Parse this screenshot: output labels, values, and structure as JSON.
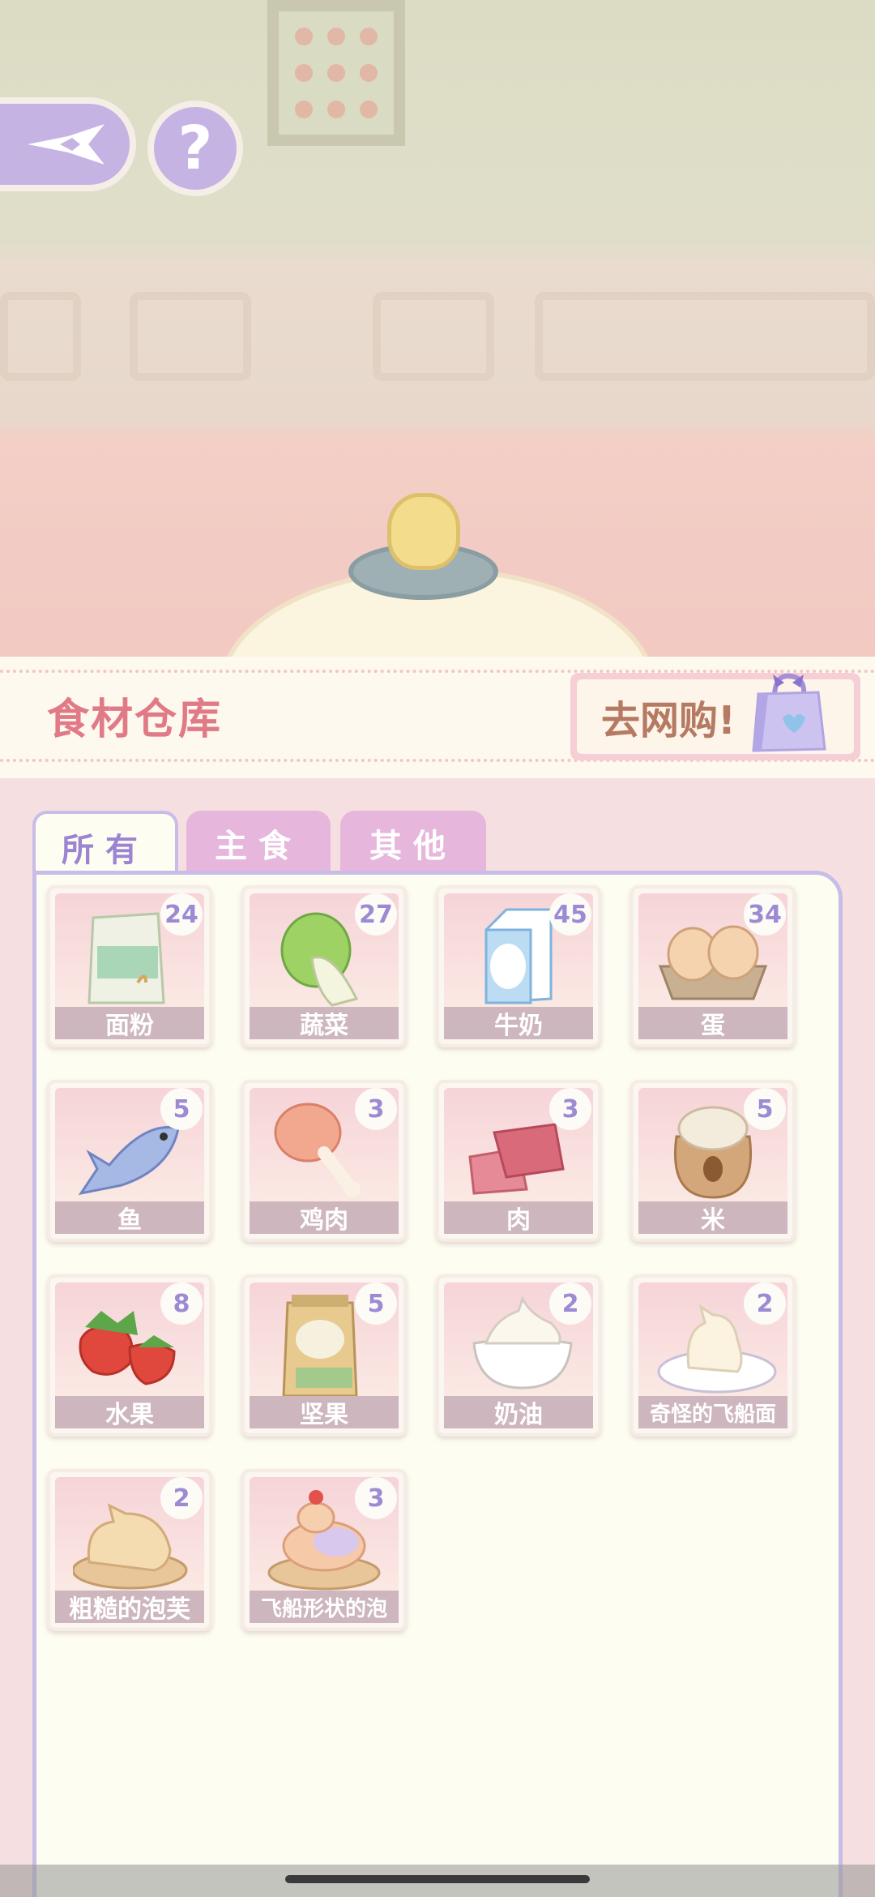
{
  "header": {
    "title": "食材仓库",
    "shop_label": "去网购!"
  },
  "help": {
    "label": "?"
  },
  "tabs": [
    {
      "label": "所有",
      "active": true
    },
    {
      "label": "主食",
      "active": false
    },
    {
      "label": "其他",
      "active": false
    }
  ],
  "items": [
    {
      "name": "面粉",
      "count": "24",
      "icon": "flour-bag-icon"
    },
    {
      "name": "蔬菜",
      "count": "27",
      "icon": "cabbage-icon"
    },
    {
      "name": "牛奶",
      "count": "45",
      "icon": "milk-carton-icon"
    },
    {
      "name": "蛋",
      "count": "34",
      "icon": "egg-carton-icon"
    },
    {
      "name": "鱼",
      "count": "5",
      "icon": "fish-icon"
    },
    {
      "name": "鸡肉",
      "count": "3",
      "icon": "chicken-leg-icon"
    },
    {
      "name": "肉",
      "count": "3",
      "icon": "meat-icon"
    },
    {
      "name": "米",
      "count": "5",
      "icon": "rice-sack-icon"
    },
    {
      "name": "水果",
      "count": "8",
      "icon": "strawberry-icon"
    },
    {
      "name": "坚果",
      "count": "5",
      "icon": "nuts-bag-icon"
    },
    {
      "name": "奶油",
      "count": "2",
      "icon": "cream-bowl-icon"
    },
    {
      "name": "奇怪的飞船面",
      "count": "2",
      "icon": "odd-dish-icon"
    },
    {
      "name": "粗糙的泡芙",
      "count": "2",
      "icon": "rough-puff-icon"
    },
    {
      "name": "飞船形状的泡",
      "count": "3",
      "icon": "airship-puff-icon"
    }
  ],
  "colors": {
    "accent": "#9c8bd4",
    "title": "#e07a86",
    "tab_inactive": "#e6b6dc",
    "panel_border": "#c8bde8"
  }
}
